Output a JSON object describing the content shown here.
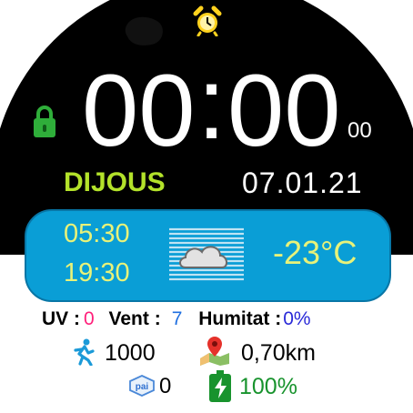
{
  "clock": {
    "hours": "00",
    "separator": ":",
    "minutes": "00",
    "seconds": "00"
  },
  "day": "DIJOUS",
  "date": "07.01.21",
  "weather": {
    "sunrise": "05:30",
    "sunset": "19:30",
    "temperature": "-23°C",
    "condition_icon": "cloud-fog-icon"
  },
  "stats": {
    "uv_label": "UV :",
    "uv_value": "0",
    "wind_label": "Vent :",
    "wind_value": "7",
    "humidity_label": "Humitat :",
    "humidity_value": "0%"
  },
  "activity": {
    "steps": "1000",
    "distance": "0,70km",
    "pai": "0",
    "battery": "100%"
  },
  "colors": {
    "accent_day": "#b3e22a",
    "panel": "#0a9ed6",
    "panel_text": "#e8f279",
    "uv": "#ff1f7a",
    "wind": "#1f6fe0",
    "battery": "#18932d",
    "lock": "#2fae3a",
    "alarm": "#ffd21e"
  }
}
